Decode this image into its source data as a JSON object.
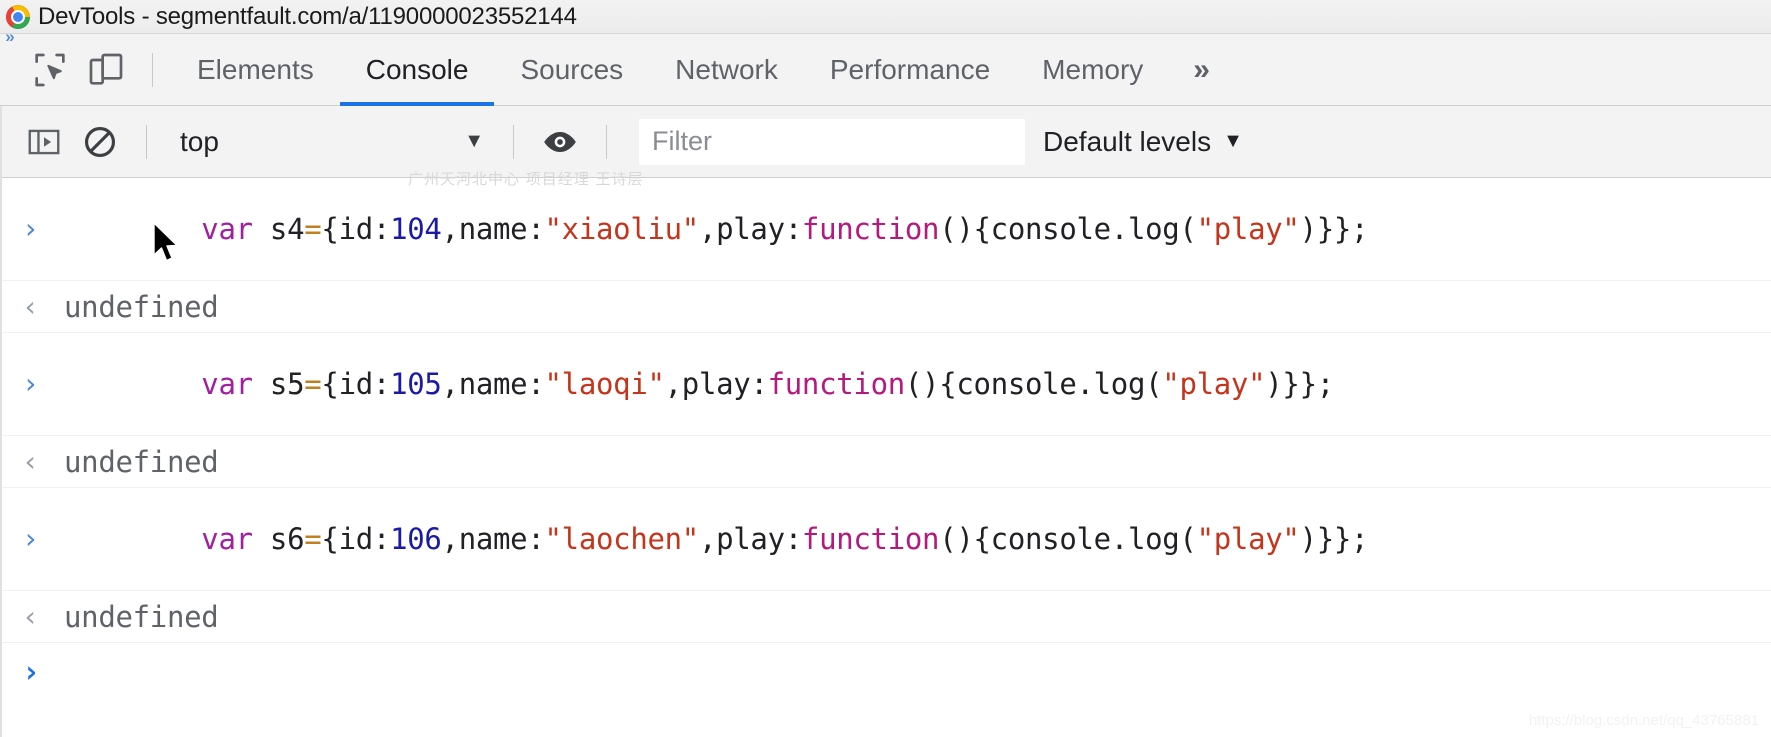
{
  "window": {
    "title": "DevTools - segmentfault.com/a/1190000023552144",
    "logo_icon": "chrome-logo-icon",
    "side_rail_icon": "double-chevron-right-icon"
  },
  "toolbar": {
    "inspect_icon": "inspect-element-icon",
    "device_icon": "device-toolbar-icon",
    "tabs": [
      {
        "label": "Elements",
        "active": false
      },
      {
        "label": "Console",
        "active": true
      },
      {
        "label": "Sources",
        "active": false
      },
      {
        "label": "Network",
        "active": false
      },
      {
        "label": "Performance",
        "active": false
      },
      {
        "label": "Memory",
        "active": false
      }
    ],
    "overflow_label": "»",
    "active_tab_underline_color": "#1a73e8"
  },
  "console_toolbar": {
    "sidebar_toggle_icon": "console-sidebar-toggle-icon",
    "clear_icon": "clear-console-icon",
    "context_value": "top",
    "context_caret": "▼",
    "eye_icon": "create-live-expression-eye-icon",
    "filter_placeholder": "Filter",
    "levels_label": "Default levels",
    "levels_caret": "▼"
  },
  "console": {
    "input_gutter": "›",
    "output_gutter": "‹",
    "prompt_gutter": "›",
    "messages": [
      {
        "type": "input",
        "tokens": [
          {
            "text": "var ",
            "cls": "t-kw"
          },
          {
            "text": "s4",
            "cls": "t-pl"
          },
          {
            "text": "=",
            "cls": "t-op"
          },
          {
            "text": "{id:",
            "cls": "t-pl"
          },
          {
            "text": "104",
            "cls": "t-num"
          },
          {
            "text": ",name:",
            "cls": "t-pl"
          },
          {
            "text": "\"xiaoliu\"",
            "cls": "t-str"
          },
          {
            "text": ",play:",
            "cls": "t-pl"
          },
          {
            "text": "function",
            "cls": "t-fn"
          },
          {
            "text": "(){console.log(",
            "cls": "t-pl"
          },
          {
            "text": "\"play\"",
            "cls": "t-str"
          },
          {
            "text": ")}};",
            "cls": "t-pl"
          }
        ]
      },
      {
        "type": "output",
        "text": "undefined"
      },
      {
        "type": "input",
        "tokens": [
          {
            "text": "var ",
            "cls": "t-kw"
          },
          {
            "text": "s5",
            "cls": "t-pl"
          },
          {
            "text": "=",
            "cls": "t-op"
          },
          {
            "text": "{id:",
            "cls": "t-pl"
          },
          {
            "text": "105",
            "cls": "t-num"
          },
          {
            "text": ",name:",
            "cls": "t-pl"
          },
          {
            "text": "\"laoqi\"",
            "cls": "t-str"
          },
          {
            "text": ",play:",
            "cls": "t-pl"
          },
          {
            "text": "function",
            "cls": "t-fn"
          },
          {
            "text": "(){console.log(",
            "cls": "t-pl"
          },
          {
            "text": "\"play\"",
            "cls": "t-str"
          },
          {
            "text": ")}};",
            "cls": "t-pl"
          }
        ]
      },
      {
        "type": "output",
        "text": "undefined"
      },
      {
        "type": "input",
        "tokens": [
          {
            "text": "var ",
            "cls": "t-kw"
          },
          {
            "text": "s6",
            "cls": "t-pl"
          },
          {
            "text": "=",
            "cls": "t-op"
          },
          {
            "text": "{id:",
            "cls": "t-pl"
          },
          {
            "text": "106",
            "cls": "t-num"
          },
          {
            "text": ",name:",
            "cls": "t-pl"
          },
          {
            "text": "\"laochen\"",
            "cls": "t-str"
          },
          {
            "text": ",play:",
            "cls": "t-pl"
          },
          {
            "text": "function",
            "cls": "t-fn"
          },
          {
            "text": "(){console.log(",
            "cls": "t-pl"
          },
          {
            "text": "\"play\"",
            "cls": "t-str"
          },
          {
            "text": ")}};",
            "cls": "t-pl"
          }
        ]
      },
      {
        "type": "output",
        "text": "undefined"
      }
    ]
  },
  "watermarks": {
    "chinese": "广州天河北中心 项目经理 王诗层",
    "csdn": "https://blog.csdn.net/qq_43765881"
  },
  "colors": {
    "accent": "#1a73e8",
    "keyword": "#a020a0",
    "string": "#c5341b",
    "number": "#1a1aa6",
    "function": "#b5197e",
    "operator": "#c08020"
  }
}
